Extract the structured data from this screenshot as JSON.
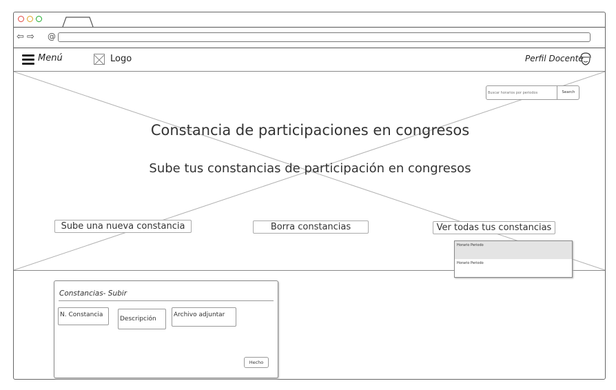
{
  "browser": {
    "url": ""
  },
  "app_bar": {
    "menu_label": "Menú",
    "logo_label": "Logo",
    "profile_label": "Perfil Docente"
  },
  "hero": {
    "search": {
      "placeholder": "Buscar horarios por periodos",
      "button": "Search"
    },
    "title": "Constancia de participaciones en congresos",
    "subtitle": "Sube tus constancias de participación en congresos",
    "actions": {
      "upload": "Sube una nueva constancia",
      "delete": "Borra constancias",
      "view_all": "Ver todas tus constancias"
    },
    "dropdown": [
      "Horario Periodo",
      "Horario Periodo"
    ]
  },
  "upload_panel": {
    "title": "Constancias- Subir",
    "fields": {
      "number": "N. Constancia",
      "description": "Descripción",
      "attachment": "Archivo adjuntar"
    },
    "done_button": "Hecho"
  },
  "icons": {
    "menu": "hamburger-icon",
    "logo": "image-placeholder-icon",
    "avatar": "user-avatar-icon",
    "back": "arrow-left-icon",
    "forward": "arrow-right-icon"
  }
}
